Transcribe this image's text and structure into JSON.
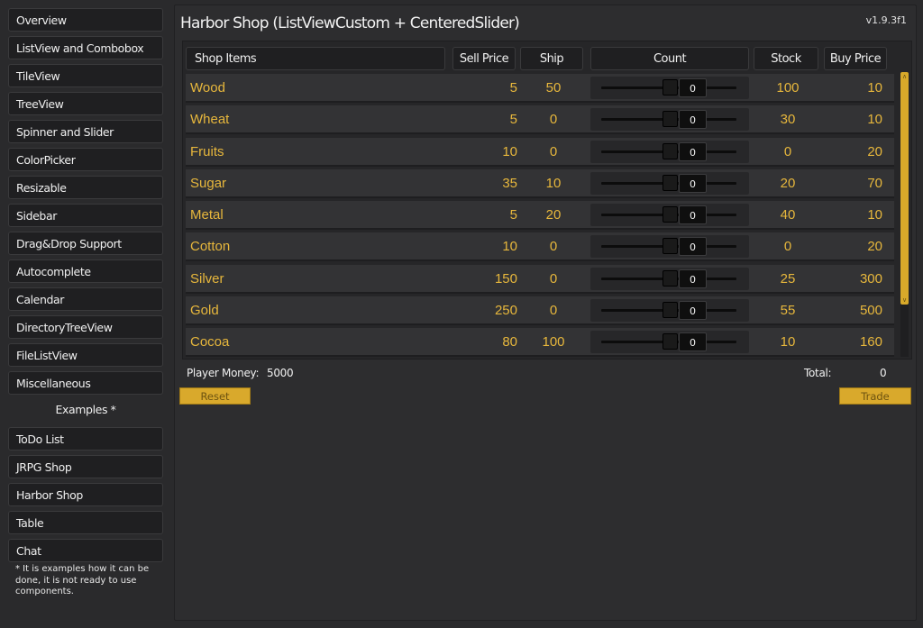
{
  "sidebar": {
    "items": [
      {
        "label": "Overview"
      },
      {
        "label": "ListView and Combobox"
      },
      {
        "label": "TileView"
      },
      {
        "label": "TreeView"
      },
      {
        "label": "Spinner and Slider"
      },
      {
        "label": "ColorPicker"
      },
      {
        "label": "Resizable"
      },
      {
        "label": "Sidebar"
      },
      {
        "label": "Drag&Drop Support"
      },
      {
        "label": "Autocomplete"
      },
      {
        "label": "Calendar"
      },
      {
        "label": "DirectoryTreeView"
      },
      {
        "label": "FileListView"
      },
      {
        "label": "Miscellaneous"
      }
    ],
    "examples_label": "Examples *",
    "examples": [
      {
        "label": "ToDo List"
      },
      {
        "label": "JRPG Shop"
      },
      {
        "label": "Harbor Shop"
      },
      {
        "label": "Table"
      },
      {
        "label": "Chat"
      }
    ],
    "note": "* It is examples how it can be done, it is not ready to use components."
  },
  "main": {
    "title": "Harbor Shop (ListViewCustom + CenteredSlider)",
    "version": "v1.9.3f1",
    "headers": {
      "items": "Shop Items",
      "sell": "Sell Price",
      "ship": "Ship",
      "count": "Count",
      "stock": "Stock",
      "buy": "Buy Price"
    },
    "rows": [
      {
        "name": "Wood",
        "sell": "5",
        "ship": "50",
        "count": "0",
        "stock": "100",
        "buy": "10"
      },
      {
        "name": "Wheat",
        "sell": "5",
        "ship": "0",
        "count": "0",
        "stock": "30",
        "buy": "10"
      },
      {
        "name": "Fruits",
        "sell": "10",
        "ship": "0",
        "count": "0",
        "stock": "0",
        "buy": "20"
      },
      {
        "name": "Sugar",
        "sell": "35",
        "ship": "10",
        "count": "0",
        "stock": "20",
        "buy": "70"
      },
      {
        "name": "Metal",
        "sell": "5",
        "ship": "20",
        "count": "0",
        "stock": "40",
        "buy": "10"
      },
      {
        "name": "Cotton",
        "sell": "10",
        "ship": "0",
        "count": "0",
        "stock": "0",
        "buy": "20"
      },
      {
        "name": "Silver",
        "sell": "150",
        "ship": "0",
        "count": "0",
        "stock": "25",
        "buy": "300"
      },
      {
        "name": "Gold",
        "sell": "250",
        "ship": "0",
        "count": "0",
        "stock": "55",
        "buy": "500"
      },
      {
        "name": "Cocoa",
        "sell": "80",
        "ship": "100",
        "count": "0",
        "stock": "10",
        "buy": "160"
      }
    ],
    "player_money_label": "Player Money:",
    "player_money": "5000",
    "total_label": "Total:",
    "total": "0",
    "reset_label": "Reset",
    "trade_label": "Trade"
  },
  "colors": {
    "accent": "#d9a92c",
    "item_text": "#e7b73c",
    "background": "#2a2a2c"
  }
}
